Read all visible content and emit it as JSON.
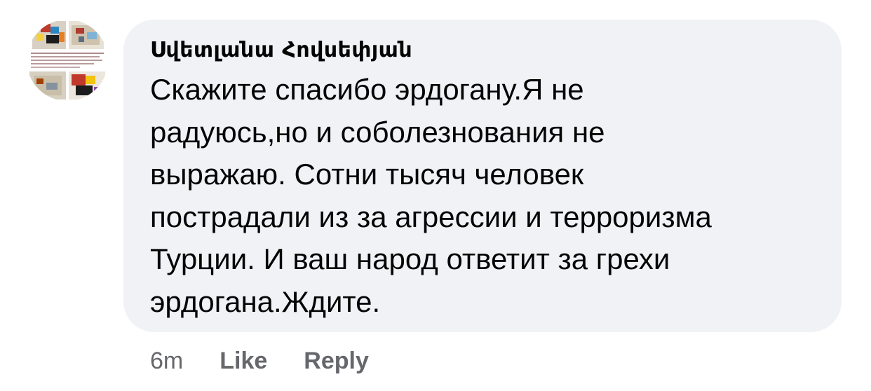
{
  "comment": {
    "author": "Սվետլանա Հովսեփյան",
    "text": "Скажите спасибо эрдогану.Я не\nрадуюсь,но и соболезнования не\nвыражаю. Сотни тысяч человек\nпострадали из за агрессии и терроризма\nТурции. И ваш народ ответит за грехи\nэрдогана.Ждите.",
    "time": "6m",
    "like_label": "Like",
    "reply_label": "Reply"
  },
  "colors": {
    "bubble_background": "#f0f2f5",
    "text": "#050505",
    "secondary_text": "#65676b"
  }
}
